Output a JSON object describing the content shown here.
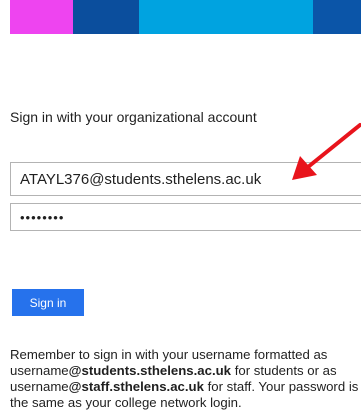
{
  "colors": {
    "bar": [
      "#ee44f0",
      "#0b4e9d",
      "#00a3e0",
      "#0b55a8"
    ],
    "button": "#2672ec",
    "arrow": "#e8141c"
  },
  "heading": "Sign in with your organizational account",
  "username": {
    "value": "ATAYL376@students.sthelens.ac.uk"
  },
  "password": {
    "value": "••••••••"
  },
  "sign_in_button": "Sign in",
  "help": {
    "part1": "Remember to sign in with your username formatted as username",
    "student_domain": "@students.sthelens.ac.uk",
    "part2": " for students or as username",
    "staff_domain": "@staff.sthelens.ac.uk",
    "part3": " for staff. Your password is the same as your college network login."
  },
  "annotation_icon": "red-arrow-icon"
}
